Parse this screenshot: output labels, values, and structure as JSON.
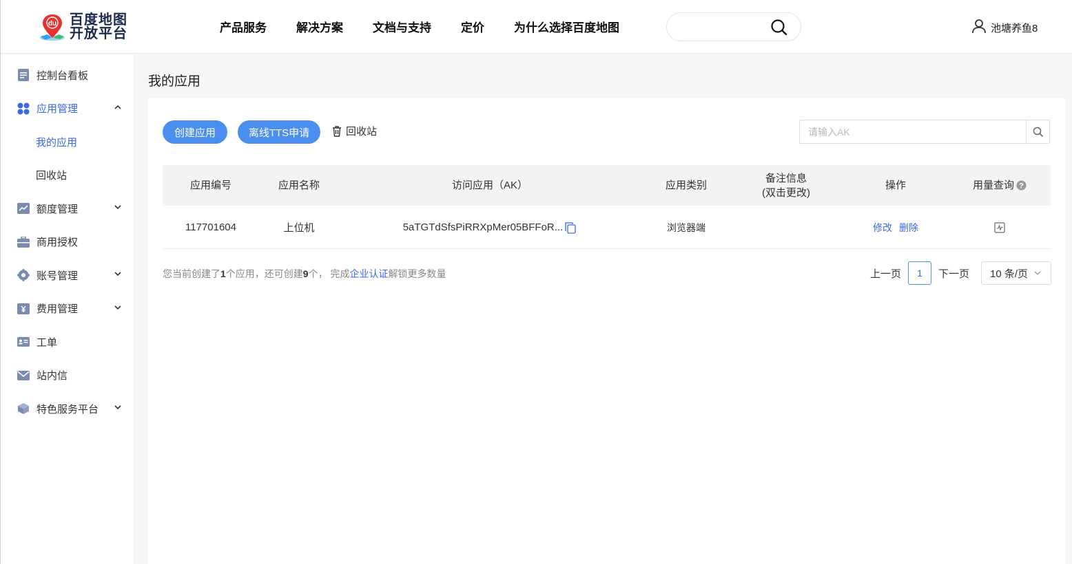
{
  "brand": {
    "line1": "百度地图",
    "line2": "开放平台",
    "mark_text": "du"
  },
  "nav": [
    "产品服务",
    "解决方案",
    "文档与支持",
    "定价",
    "为什么选择百度地图"
  ],
  "search": {
    "value": ""
  },
  "user": {
    "name": "池塘养鱼8"
  },
  "sidebar": {
    "items": [
      {
        "label": "控制台看板",
        "icon": "dashboard-icon"
      },
      {
        "label": "应用管理",
        "icon": "apps-icon",
        "expanded": true
      },
      {
        "label": "我的应用",
        "sub": true,
        "active": true
      },
      {
        "label": "回收站",
        "sub": true
      },
      {
        "label": "额度管理",
        "icon": "quota-chart-icon"
      },
      {
        "label": "商用授权",
        "icon": "briefcase-icon"
      },
      {
        "label": "账号管理",
        "icon": "account-gear-icon"
      },
      {
        "label": "费用管理",
        "icon": "yen-icon"
      },
      {
        "label": "工单",
        "icon": "ticket-icon"
      },
      {
        "label": "站内信",
        "icon": "mail-icon"
      },
      {
        "label": "特色服务平台",
        "icon": "cube-icon"
      }
    ]
  },
  "page": {
    "title": "我的应用"
  },
  "toolbar": {
    "create_label": "创建应用",
    "tts_label": "离线TTS申请",
    "recycle_label": "回收站",
    "ak_placeholder": "请输入AK"
  },
  "table": {
    "headers": {
      "id": "应用编号",
      "name": "应用名称",
      "ak": "访问应用（AK）",
      "type": "应用类别",
      "note_line1": "备注信息",
      "note_line2": "(双击更改)",
      "ops": "操作",
      "usage": "用量查询"
    },
    "rows": [
      {
        "id": "117701604",
        "name": "上位机",
        "ak": "5aTGTdSfsPiRRXpMer05BFFoR...",
        "type": "浏览器端",
        "note": "",
        "edit": "修改",
        "delete": "删除"
      }
    ]
  },
  "summary": {
    "prefix": "您当前创建了",
    "created": "1",
    "mid": "个应用，还可创建",
    "remaining": "9",
    "suffix1": "个， 完成",
    "link": "企业认证",
    "suffix2": "解锁更多数量"
  },
  "pager": {
    "prev": "上一页",
    "current": "1",
    "next": "下一页",
    "size": "10 条/页"
  },
  "colors": {
    "accent": "#4a8ef0",
    "link": "#3a68e8"
  }
}
